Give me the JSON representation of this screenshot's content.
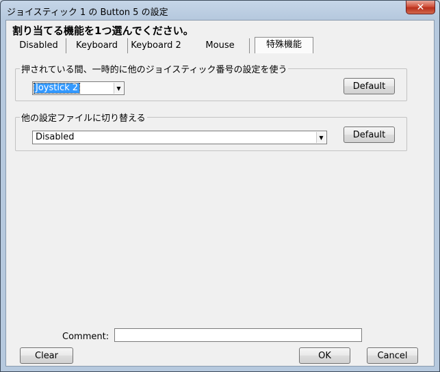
{
  "window": {
    "title": "ジョイスティック 1 の Button 5 の設定",
    "close_label": "✕"
  },
  "heading": "割り当てる機能を1つ選んでください。",
  "tabs": [
    {
      "label": "Disabled"
    },
    {
      "label": "Keyboard"
    },
    {
      "label": "Keyboard 2"
    },
    {
      "label": "Mouse"
    },
    {
      "label": "特殊機能",
      "active": true
    }
  ],
  "group1": {
    "label": "押されている間、一時的に他のジョイスティック番号の設定を使う",
    "select_value": "Joystick 2",
    "default_label": "Default"
  },
  "group2": {
    "label": "他の設定ファイルに切り替える",
    "select_value": "Disabled",
    "default_label": "Default"
  },
  "comment": {
    "label": "Comment:",
    "value": ""
  },
  "buttons": {
    "clear": "Clear",
    "ok": "OK",
    "cancel": "Cancel"
  }
}
